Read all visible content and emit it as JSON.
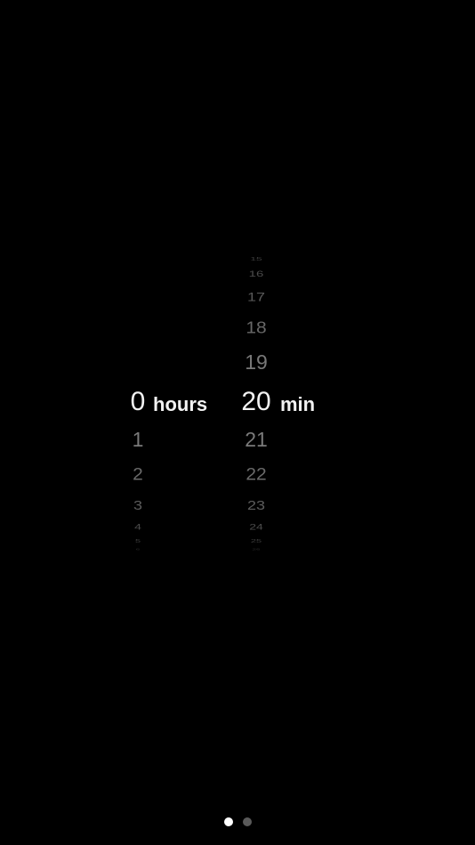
{
  "duration_picker": {
    "hours": {
      "selected": "0",
      "unit": "hours",
      "below": [
        "1",
        "2",
        "3",
        "4",
        "5",
        "6"
      ]
    },
    "minutes": {
      "selected": "20",
      "unit": "min",
      "above": [
        "15",
        "16",
        "17",
        "18",
        "19"
      ],
      "below": [
        "21",
        "22",
        "23",
        "24",
        "25",
        "26"
      ]
    }
  },
  "page_indicator": {
    "pages": 2,
    "current_page": 1
  },
  "colors": {
    "background": "#000000",
    "selected_text": "#f2f2f2",
    "unselected_text": "#6d6d6d",
    "active_dot": "#ffffff",
    "inactive_dot": "#5a5a5a"
  }
}
